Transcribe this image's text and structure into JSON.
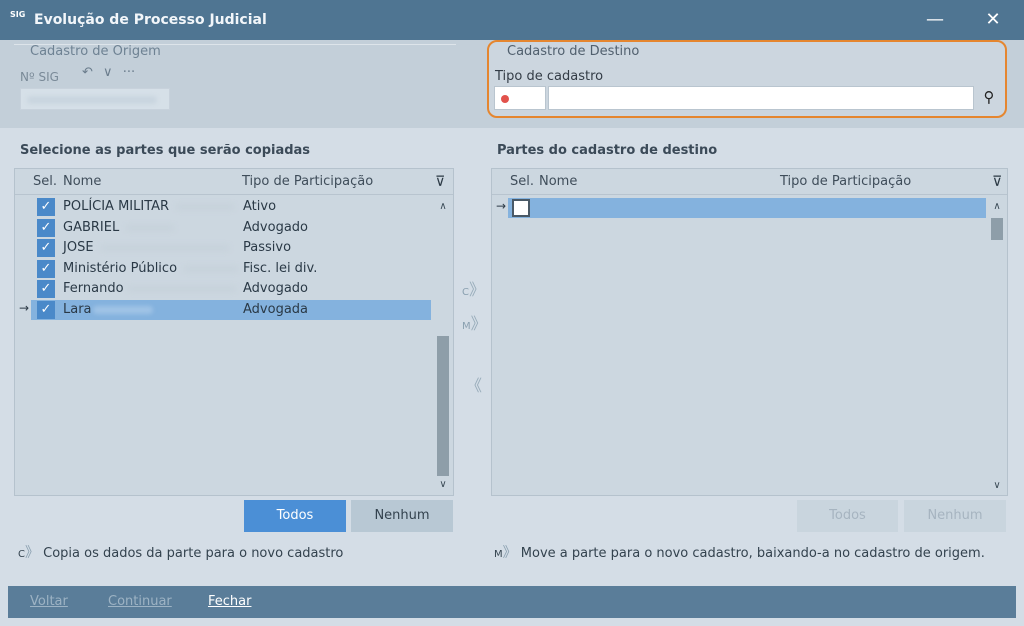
{
  "window": {
    "app_icon": "SIG",
    "title": "Evolução de Processo Judicial",
    "minimize_glyph": "—",
    "close_glyph": "✕"
  },
  "origin": {
    "legend": "Cadastro de Origem",
    "sig_label": "Nº SIG",
    "undo_glyph": "↶",
    "dropdown_glyph": "∨",
    "more_glyph": "···"
  },
  "destination": {
    "legend": "Cadastro de Destino",
    "tipo_label": "Tipo de cadastro",
    "tipo_value": "",
    "search_glyph": "⚲"
  },
  "left_panel": {
    "title": "Selecione as partes que serão copiadas",
    "columns": {
      "sel": "Sel.",
      "nome": "Nome",
      "tipo": "Tipo de Participação"
    },
    "rows": [
      {
        "nome": "POLÍCIA MILITAR",
        "tipo": "Ativo",
        "checked": true
      },
      {
        "nome": "GABRIEL",
        "tipo": "Advogado",
        "checked": true
      },
      {
        "nome": "JOSE",
        "tipo": "Passivo",
        "checked": true
      },
      {
        "nome": "Ministério Público",
        "tipo": "Fisc. lei div.",
        "checked": true
      },
      {
        "nome": "Fernando",
        "tipo": "Advogado",
        "checked": true
      },
      {
        "nome": "Lara",
        "tipo": "Advogada",
        "checked": true,
        "selected": true
      }
    ],
    "todos": "Todos",
    "nenhum": "Nenhum"
  },
  "right_panel": {
    "title": "Partes do cadastro de destino",
    "columns": {
      "sel": "Sel.",
      "nome": "Nome",
      "tipo": "Tipo de Participação"
    },
    "todos": "Todos",
    "nenhum": "Nenhum"
  },
  "transfer": {
    "copy_key": "C",
    "move_key": "M",
    "chevron": "》",
    "back_chevron": "《"
  },
  "notes": {
    "copy_key": "C",
    "copy_text": "Copia os dados da parte para o novo cadastro",
    "move_key": "M",
    "move_text": "Move a parte para o novo cadastro, baixando-a no cadastro de origem."
  },
  "footer": {
    "voltar": "Voltar",
    "continuar": "Continuar",
    "fechar": "Fechar"
  },
  "colors": {
    "titlebar": "#4f7592",
    "accent_highlight": "#e5862f",
    "primary_button": "#4b8fd6",
    "selected_row": "#84b2de"
  }
}
